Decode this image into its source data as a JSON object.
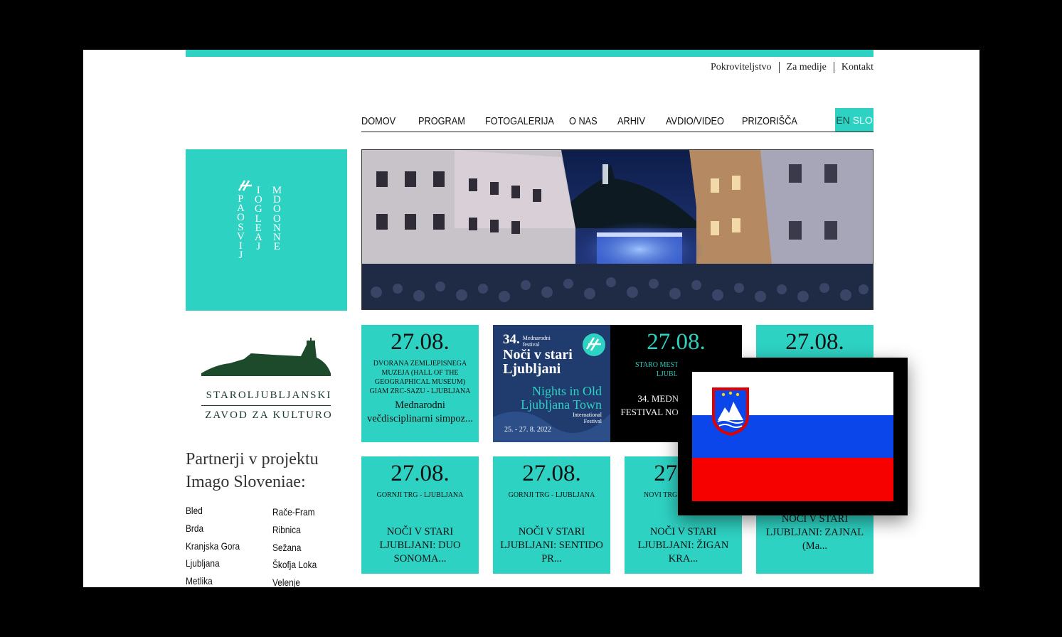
{
  "top_links": [
    "Pokroviteljstvo",
    "Za medije",
    "Kontakt"
  ],
  "nav": {
    "items": [
      "DOMOV",
      "PROGRAM",
      "FOTOGALERIJA",
      "O NAS",
      "ARHIV",
      "AVDIO/VIDEO",
      "PRIZORIŠČA"
    ],
    "lang_en": "EN",
    "lang_slo": "SLO"
  },
  "logo": {
    "columns": [
      [
        "P",
        "A",
        "O",
        "S",
        "V",
        "I",
        "J"
      ],
      [
        "I",
        "O",
        "G",
        "L",
        "E",
        "A",
        "J"
      ],
      [
        "M",
        "D",
        "O",
        "O",
        "N",
        "N",
        "E"
      ]
    ]
  },
  "institution": {
    "line1": "STAROLJUBLJANSKI",
    "line2": "ZAVOD ZA KULTURO"
  },
  "partners": {
    "title_line1": "Partnerji v projektu",
    "title_line2": "Imago Sloveniae:",
    "col1": [
      "Bled",
      "Brda",
      "Kranjska Gora",
      "Ljubljana",
      "Metlika"
    ],
    "col2": [
      "Rače-Fram",
      "Ribnica",
      "Sežana",
      "Škofja Loka",
      "Velenje"
    ]
  },
  "cards_row1": [
    {
      "date": "27.08.",
      "venue": "DVORANA ZEMLJEPISNEGA MUZEJA (HALL OF THE GEOGRAPHICAL MUSEUM) GIAM ZRC-SAZU - LJUBLJANA",
      "title": "Mednarodni večdisciplinarni simpoz..."
    },
    {
      "poster_num": "34.",
      "poster_small": "Mednarodni festival",
      "poster_title1": "Noči v stari",
      "poster_title2": "Ljubljani",
      "poster_en1": "Nights in Old",
      "poster_en2": "Ljubljana Town",
      "poster_en3": "International Festival",
      "poster_dates": "25. - 27. 8. 2022"
    },
    {
      "date": "27.08.",
      "venue": "STARO MESTNO JEDRO - LJUBLJANA",
      "title": "34. MEDNARODNI FESTIVAL NOČI V STARI..."
    },
    {
      "date": "27.08.",
      "venue": "",
      "title": ""
    }
  ],
  "cards_row2": [
    {
      "date": "27.08.",
      "venue": "GORNJI TRG - LJUBLJANA",
      "title": "NOČI V STARI LJUBLJANI: DUO SONOMA..."
    },
    {
      "date": "27.08.",
      "venue": "GORNJI TRG - LJUBLJANA",
      "title": "NOČI V STARI LJUBLJANI: SENTIDO PR..."
    },
    {
      "date": "27.08.",
      "venue": "NOVI TRG - LJUBLJANA",
      "title": "NOČI V STARI LJUBLJANI: ŽIGAN KRA..."
    },
    {
      "date": "",
      "venue": "",
      "title": "NOČI V STARI LJUBLJANI: ZAJNAL (Ma..."
    }
  ],
  "colors": {
    "accent": "#2ed2c3",
    "flag_white": "#ffffff",
    "flag_blue": "#0b46ea",
    "flag_red": "#f70000"
  }
}
